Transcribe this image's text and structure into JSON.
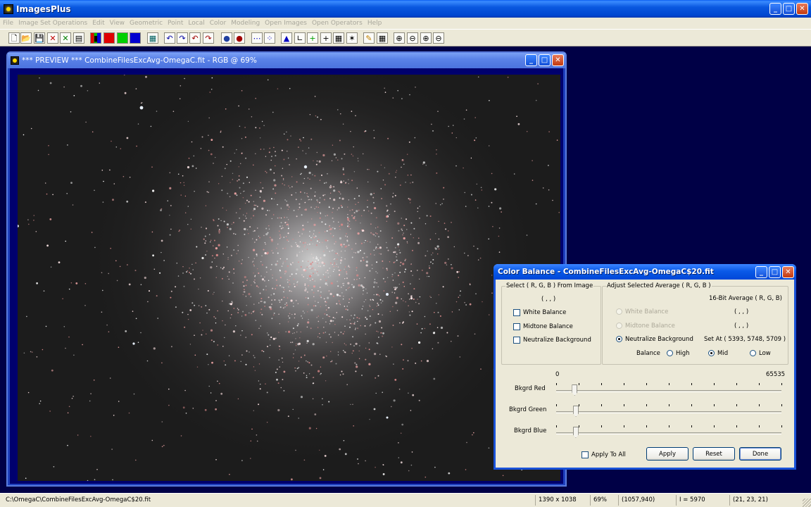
{
  "app": {
    "title": "ImagesPlus"
  },
  "window_controls": {
    "minimize": "_",
    "maximize": "□",
    "close": "✕"
  },
  "menu": [
    "File",
    "Image Set Operations",
    "Edit",
    "View",
    "Geometric",
    "Point",
    "Local",
    "Color",
    "Modeling",
    "Open Images",
    "Open Operators",
    "Help"
  ],
  "toolbar": {
    "icons": [
      {
        "name": "new-icon",
        "glyph": "🗋"
      },
      {
        "name": "open-icon",
        "glyph": "📂"
      },
      {
        "name": "save-icon",
        "glyph": "💾"
      },
      {
        "name": "close-red-icon",
        "glyph": "✕"
      },
      {
        "name": "close-green-icon",
        "glyph": "✕"
      },
      {
        "name": "print-icon",
        "glyph": "▤"
      },
      {
        "name": "rgb-channels-icon",
        "glyph": "▮"
      },
      {
        "name": "red-channel-icon",
        "glyph": ""
      },
      {
        "name": "green-channel-icon",
        "glyph": ""
      },
      {
        "name": "blue-channel-icon",
        "glyph": ""
      },
      {
        "name": "grid-icon",
        "glyph": "▦"
      },
      {
        "name": "undo-icon",
        "glyph": "↶"
      },
      {
        "name": "redo-icon",
        "glyph": "↷"
      },
      {
        "name": "undo-all-icon",
        "glyph": "↶"
      },
      {
        "name": "redo-all-icon",
        "glyph": "↷"
      },
      {
        "name": "circle-tool-icon",
        "glyph": "●"
      },
      {
        "name": "stop-icon",
        "glyph": "●"
      },
      {
        "name": "dots-icon",
        "glyph": "⋯"
      },
      {
        "name": "scatter-icon",
        "glyph": "⁘"
      },
      {
        "name": "histogram-icon",
        "glyph": "▲"
      },
      {
        "name": "curve-icon",
        "glyph": "∟"
      },
      {
        "name": "crosshair-green-icon",
        "glyph": "+"
      },
      {
        "name": "crosshair-icon",
        "glyph": "+"
      },
      {
        "name": "calculator-icon",
        "glyph": "▦"
      },
      {
        "name": "star-tool-icon",
        "glyph": "✶"
      },
      {
        "name": "pencil-icon",
        "glyph": "✎"
      },
      {
        "name": "table-icon",
        "glyph": "▦"
      },
      {
        "name": "zoom-in-icon",
        "glyph": "⊕"
      },
      {
        "name": "zoom-out-icon",
        "glyph": "⊖"
      },
      {
        "name": "zoom-fit-icon",
        "glyph": "⊕"
      },
      {
        "name": "zoom-actual-icon",
        "glyph": "⊖"
      }
    ]
  },
  "preview": {
    "title": "*** PREVIEW *** CombineFilesExcAvg-OmegaC.fit - RGB @ 69%"
  },
  "dialog": {
    "title": "Color Balance - CombineFilesExcAvg-OmegaC$20.fit",
    "select_group": {
      "legend": "Select ( R, G, B ) From Image",
      "rgb_value": "( , , )",
      "options": [
        {
          "label": "White Balance",
          "checked": false
        },
        {
          "label": "Midtone Balance",
          "checked": false
        },
        {
          "label": "Neutralize Background",
          "checked": false
        }
      ]
    },
    "adjust_group": {
      "legend": "Adjust Selected Average ( R, G, B )",
      "avg_header": "16-Bit Average ( R, G, B)",
      "options": [
        {
          "label": "White Balance",
          "value": "( , , )",
          "enabled": false,
          "checked": false
        },
        {
          "label": "Midtone Balance",
          "value": "( , , )",
          "enabled": false,
          "checked": false
        },
        {
          "label": "Neutralize Background",
          "value": "Set At ( 5393, 5748, 5709 )",
          "enabled": true,
          "checked": true
        }
      ],
      "balance_label": "Balance",
      "balance_options": [
        {
          "label": "High",
          "checked": false
        },
        {
          "label": "Mid",
          "checked": true
        },
        {
          "label": "Low",
          "checked": false
        }
      ]
    },
    "scale": {
      "min": "0",
      "max": "65535"
    },
    "sliders": [
      {
        "label": "Bkgrd Red",
        "value": 5393
      },
      {
        "label": "Bkgrd Green",
        "value": 5748
      },
      {
        "label": "Bkgrd Blue",
        "value": 5709
      }
    ],
    "apply_to_all": {
      "label": "Apply To All",
      "checked": false
    },
    "buttons": {
      "apply": "Apply",
      "reset": "Reset",
      "done": "Done"
    }
  },
  "statusbar": {
    "path": "C:\\OmegaC\\CombineFilesExcAvg-OmegaC$20.fit",
    "dimensions": "1390 x 1038",
    "zoom": "69%",
    "cursor": "(1057,940)",
    "intensity": "I = 5970",
    "rgb": "(21, 23, 21)"
  },
  "colors": {
    "desktop": "#000046",
    "xp_blue": "#0a5ae8",
    "window_face": "#ece9d8"
  }
}
